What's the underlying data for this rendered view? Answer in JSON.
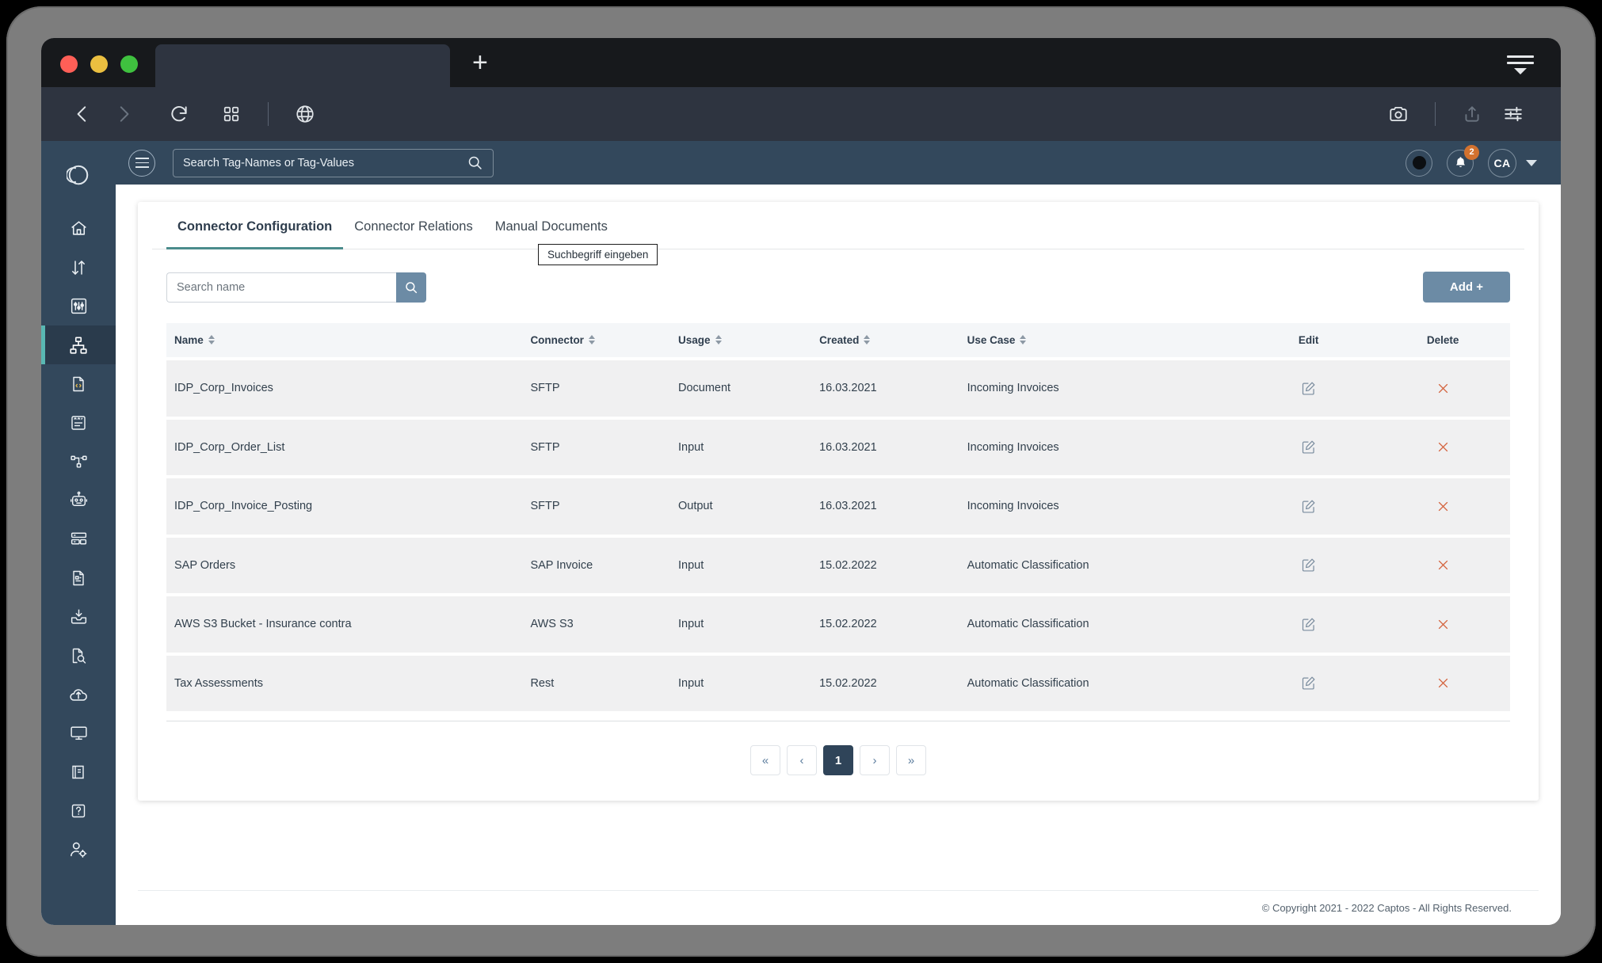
{
  "browser": {
    "tab_title": "",
    "new_tab_label": "+",
    "icons": {
      "back": "back-arrow-icon",
      "forward": "forward-arrow-icon",
      "reload": "reload-icon",
      "grid": "grid-apps-icon",
      "globe": "globe-icon",
      "camera": "camera-icon",
      "share": "share-upload-icon",
      "settings": "sliders-icon",
      "menu": "hamburger-menu-icon"
    }
  },
  "app_header": {
    "menu_icon": "hamburger-icon",
    "search": {
      "placeholder": "Search Tag-Names or Tag-Values",
      "value": "",
      "icon": "search-icon"
    },
    "notifications": {
      "count": "2",
      "icon": "bell-icon"
    },
    "avatar_initials": "CA",
    "status_icon": "record-dot-icon"
  },
  "sidebar": {
    "items": [
      {
        "name": "logo",
        "icon": "contrast-circle-logo"
      },
      {
        "name": "home",
        "icon": "home-icon"
      },
      {
        "name": "transfer",
        "icon": "arrows-up-down-icon"
      },
      {
        "name": "settings-panel",
        "icon": "sliders-box-icon"
      },
      {
        "name": "connectors",
        "icon": "sitemap-icon",
        "active": true
      },
      {
        "name": "code-document",
        "icon": "file-code-icon"
      },
      {
        "name": "checklist",
        "icon": "clipboard-list-icon"
      },
      {
        "name": "workflow",
        "icon": "nodes-icon"
      },
      {
        "name": "bot",
        "icon": "robot-icon"
      },
      {
        "name": "server",
        "icon": "server-icon"
      },
      {
        "name": "invoice",
        "icon": "file-invoice-icon"
      },
      {
        "name": "inbox-download",
        "icon": "inbox-download-icon"
      },
      {
        "name": "document-search",
        "icon": "file-search-icon"
      },
      {
        "name": "cloud-upload",
        "icon": "cloud-upload-icon"
      },
      {
        "name": "monitor",
        "icon": "desktop-icon"
      },
      {
        "name": "book",
        "icon": "book-icon"
      },
      {
        "name": "help",
        "icon": "question-box-icon"
      },
      {
        "name": "user-settings",
        "icon": "user-gear-icon"
      }
    ]
  },
  "main": {
    "tabs": [
      {
        "label": "Connector Configuration",
        "active": true
      },
      {
        "label": "Connector Relations",
        "active": false
      },
      {
        "label": "Manual Documents",
        "active": false
      }
    ],
    "search": {
      "placeholder": "Search name",
      "value": "",
      "icon": "search-icon"
    },
    "tooltip": "Suchbegriff eingeben",
    "add_button": "Add +",
    "table": {
      "columns": [
        {
          "label": "Name",
          "sortable": true
        },
        {
          "label": "Connector",
          "sortable": true
        },
        {
          "label": "Usage",
          "sortable": true
        },
        {
          "label": "Created",
          "sortable": true
        },
        {
          "label": "Use Case",
          "sortable": true
        },
        {
          "label": "Edit",
          "sortable": false
        },
        {
          "label": "Delete",
          "sortable": false
        }
      ],
      "rows": [
        {
          "name": "IDP_Corp_Invoices",
          "connector": "SFTP",
          "usage": "Document",
          "created": "16.03.2021",
          "use_case": "Incoming Invoices"
        },
        {
          "name": "IDP_Corp_Order_List",
          "connector": "SFTP",
          "usage": "Input",
          "created": "16.03.2021",
          "use_case": "Incoming Invoices"
        },
        {
          "name": "IDP_Corp_Invoice_Posting",
          "connector": "SFTP",
          "usage": "Output",
          "created": "16.03.2021",
          "use_case": "Incoming Invoices"
        },
        {
          "name": "SAP Orders",
          "connector": "SAP Invoice",
          "usage": "Input",
          "created": "15.02.2022",
          "use_case": "Automatic Classification"
        },
        {
          "name": "AWS S3 Bucket - Insurance contra",
          "connector": "AWS S3",
          "usage": "Input",
          "created": "15.02.2022",
          "use_case": "Automatic Classification"
        },
        {
          "name": "Tax Assessments",
          "connector": "Rest",
          "usage": "Input",
          "created": "15.02.2022",
          "use_case": "Automatic Classification"
        }
      ],
      "edit_icon": "pencil-square-icon",
      "delete_icon": "close-x-icon"
    },
    "pagination": {
      "first": "«",
      "prev": "‹",
      "pages": [
        "1"
      ],
      "current": "1",
      "next": "›",
      "last": "»"
    }
  },
  "footer": {
    "copyright": "© Copyright 2021 - 2022 Captos - All Rights Reserved."
  },
  "colors": {
    "sidebar_bg": "#33485c",
    "sidebar_active_bg": "#2a3b4c",
    "accent_teal": "#59b8b3",
    "button_blue": "#6c8ba5",
    "badge_orange": "#d2722f",
    "delete_red": "#d4623c",
    "browser_toolbar": "#2e3440",
    "tabbar_bg": "#17191c",
    "row_bg": "#f0f0f1",
    "header_row_bg": "#f4f6f8"
  }
}
